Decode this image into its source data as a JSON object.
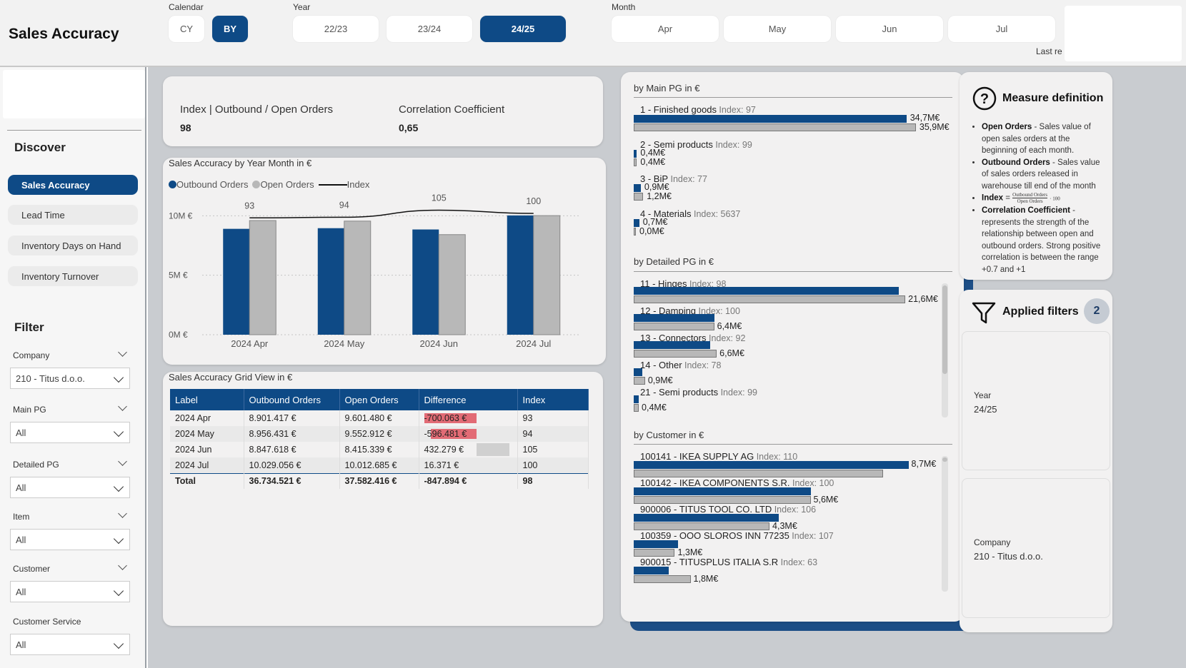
{
  "header": {
    "title": "Sales Accuracy",
    "calendar": {
      "label": "Calendar",
      "options": [
        "CY",
        "BY"
      ],
      "selected": "BY"
    },
    "year": {
      "label": "Year",
      "options": [
        "22/23",
        "23/24",
        "24/25"
      ],
      "selected": "24/25"
    },
    "month": {
      "label": "Month",
      "options": [
        "Apr",
        "May",
        "Jun",
        "Jul"
      ]
    },
    "last_refresh_fragment": "Last re"
  },
  "nav": {
    "discover_title": "Discover",
    "items": [
      "Sales Accuracy",
      "Lead Time",
      "Inventory Days on Hand",
      "Inventory Turnover"
    ],
    "active": "Sales Accuracy",
    "filter_title": "Filter",
    "filters": [
      {
        "label": "Company",
        "value": "210 - Titus d.o.o."
      },
      {
        "label": "Main PG",
        "value": "All"
      },
      {
        "label": "Detailed PG",
        "value": "All"
      },
      {
        "label": "Item",
        "value": "All"
      },
      {
        "label": "Customer",
        "value": "All"
      },
      {
        "label": "Customer Service",
        "value": "All"
      }
    ]
  },
  "kpi": {
    "index_label": "Index | Outbound / Open Orders",
    "index_value": "98",
    "corr_label": "Correlation Coefficient",
    "corr_value": "0,65"
  },
  "chart_data": [
    {
      "type": "bar",
      "title": "Sales Accuracy by Year Month in €",
      "legend": [
        "Outbound Orders",
        "Open Orders",
        "Index"
      ],
      "categories": [
        "2024 Apr",
        "2024 May",
        "2024 Jun",
        "2024 Jul"
      ],
      "series": [
        {
          "name": "Outbound Orders",
          "values": [
            8901417,
            8956431,
            8847618,
            10029056
          ],
          "color": "#0e4a86"
        },
        {
          "name": "Open Orders",
          "values": [
            9601480,
            9552912,
            8415339,
            10012685
          ],
          "color": "#b8b8b8"
        },
        {
          "name": "Index",
          "type": "line",
          "values": [
            93,
            94,
            105,
            100
          ],
          "color": "#111111"
        }
      ],
      "ylim": [
        0,
        12000000
      ],
      "yticks": [
        "0M €",
        "5M €",
        "10M €"
      ],
      "ytick_values": [
        0,
        5000000,
        10000000
      ]
    },
    {
      "type": "bar",
      "orientation": "horizontal",
      "title": "by Main PG in €",
      "categories": [
        "1 - Finished goods",
        "2 - Semi products",
        "3 - BiP",
        "4 - Materials"
      ],
      "index_labels": [
        "Index: 97",
        "Index: 99",
        "Index: 77",
        "Index: 5637"
      ],
      "series": [
        {
          "name": "Outbound Orders",
          "values": [
            34.7,
            0.4,
            0.9,
            0.7
          ],
          "labels": [
            "34,7M€",
            "0,4M€",
            "0,9M€",
            "0,7M€"
          ]
        },
        {
          "name": "Open Orders",
          "values": [
            35.9,
            0.4,
            1.2,
            0.0
          ],
          "labels": [
            "35,9M€",
            "0,4M€",
            "1,2M€",
            "0,0M€"
          ]
        }
      ]
    },
    {
      "type": "bar",
      "orientation": "horizontal",
      "title": "by Detailed PG in €",
      "categories": [
        "11 - Hinges",
        "12 - Damping",
        "13 - Connectors",
        "14 - Other",
        "21 - Semi products"
      ],
      "index_labels": [
        "Index: 98",
        "Index: 100",
        "Index: 92",
        "Index: 78",
        "Index: 99"
      ],
      "series": [
        {
          "name": "Outbound Orders",
          "values": [
            21.1,
            6.4,
            6.1,
            0.7,
            0.4
          ]
        },
        {
          "name": "Open Orders",
          "values": [
            21.6,
            6.4,
            6.6,
            0.9,
            0.4
          ],
          "labels": [
            "21,6M€",
            "6,4M€",
            "6,6M€",
            "0,9M€",
            "0,4M€"
          ]
        }
      ]
    },
    {
      "type": "bar",
      "orientation": "horizontal",
      "title": "by Customer in €",
      "categories": [
        "100141 - IKEA SUPPLY AG",
        "100142 - IKEA COMPONENTS S.R.",
        "900006 - TITUS TOOL CO. LTD",
        "100359 - OOO SLOROS INN 77235",
        "900015 - TITUSPLUS ITALIA S.R"
      ],
      "index_labels": [
        "Index: 110",
        "Index: 100",
        "Index: 106",
        "Index: 107",
        "Index: 63"
      ],
      "series": [
        {
          "name": "Outbound Orders",
          "values": [
            8.7,
            5.6,
            4.6,
            1.4,
            1.1
          ],
          "labels": [
            "8,7M€",
            "",
            "",
            "",
            ""
          ]
        },
        {
          "name": "Open Orders",
          "values": [
            7.9,
            5.6,
            4.3,
            1.3,
            1.8
          ],
          "labels": [
            "",
            "5,6M€",
            "4,3M€",
            "1,3M€",
            "1,8M€"
          ]
        }
      ]
    }
  ],
  "grid": {
    "title": "Sales Accuracy Grid View in €",
    "columns": [
      "Label",
      "Outbound Orders",
      "Open Orders",
      "Difference",
      "Index"
    ],
    "rows": [
      [
        "2024 Apr",
        "8.901.417 €",
        "9.601.480 €",
        "-700.063 €",
        "93"
      ],
      [
        "2024 May",
        "8.956.431 €",
        "9.552.912 €",
        "-596.481 €",
        "94"
      ],
      [
        "2024 Jun",
        "8.847.618 €",
        "8.415.339 €",
        "432.279 €",
        "105"
      ],
      [
        "2024 Jul",
        "10.029.056 €",
        "10.012.685 €",
        "16.371 €",
        "100"
      ]
    ],
    "total": [
      "Total",
      "36.734.521 €",
      "37.582.416 €",
      "-847.894 €",
      "98"
    ]
  },
  "definitions": {
    "title": "Measure definition",
    "items": [
      {
        "term": "Open Orders",
        "text": " - Sales value of open sales orders at the beginning of each month."
      },
      {
        "term": "Outbound Orders",
        "text": " - Sales value of sales orders released in warehouse till end of the month"
      },
      {
        "term": "Index",
        "text": " = ",
        "formula_num": "Outbound Orders",
        "formula_den": "Open Orders",
        "formula_mult": "· 100"
      },
      {
        "term": "Correlation Coefficient",
        "text": " - represents the strength of the relationship between open and outbound orders. Strong positive correlation is between the range +0.7 and +1"
      }
    ]
  },
  "applied_filters": {
    "title": "Applied filters",
    "count": "2",
    "items": [
      {
        "label": "Year",
        "value": "24/25"
      },
      {
        "label": "Company",
        "value": "210 - Titus d.o.o."
      }
    ]
  },
  "colors": {
    "primary": "#0e4a86",
    "grey_bar": "#b8b8b8",
    "negative": "#e26b75",
    "background": "#c9ccd0"
  }
}
